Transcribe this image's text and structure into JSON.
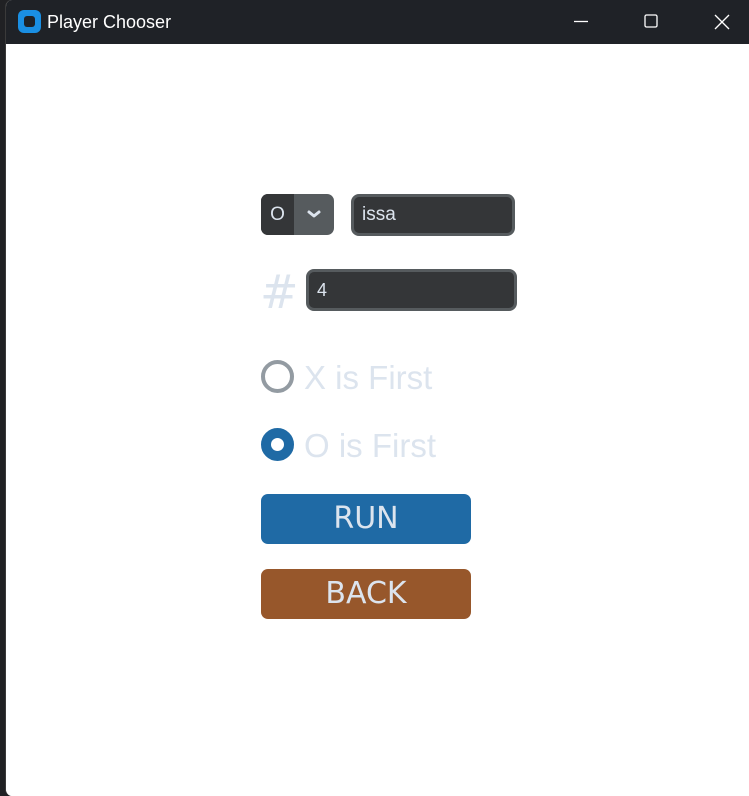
{
  "window": {
    "title": "Player Chooser",
    "controls": [
      "minimize-icon",
      "maximize-icon",
      "close-icon"
    ]
  },
  "form": {
    "player_select": {
      "value": "O",
      "options_visible": [
        "O"
      ]
    },
    "name_entry": {
      "value": "issa"
    },
    "number_label": "#",
    "number_entry": {
      "value": "4"
    },
    "radio_options": [
      {
        "label": "X is First",
        "selected": false
      },
      {
        "label": "O is First",
        "selected": true
      }
    ],
    "run_label": "RUN",
    "back_label": "BACK"
  },
  "colors": {
    "titlebar": "#1f2227",
    "app_icon": "#1a8fe3",
    "entry_bg": "#343638",
    "entry_border": "#565b5e",
    "text_light": "#dce4ee",
    "accent_blue": "#1f6aa5",
    "back_brown": "#97572b",
    "radio_unselected": "#939ba2"
  }
}
